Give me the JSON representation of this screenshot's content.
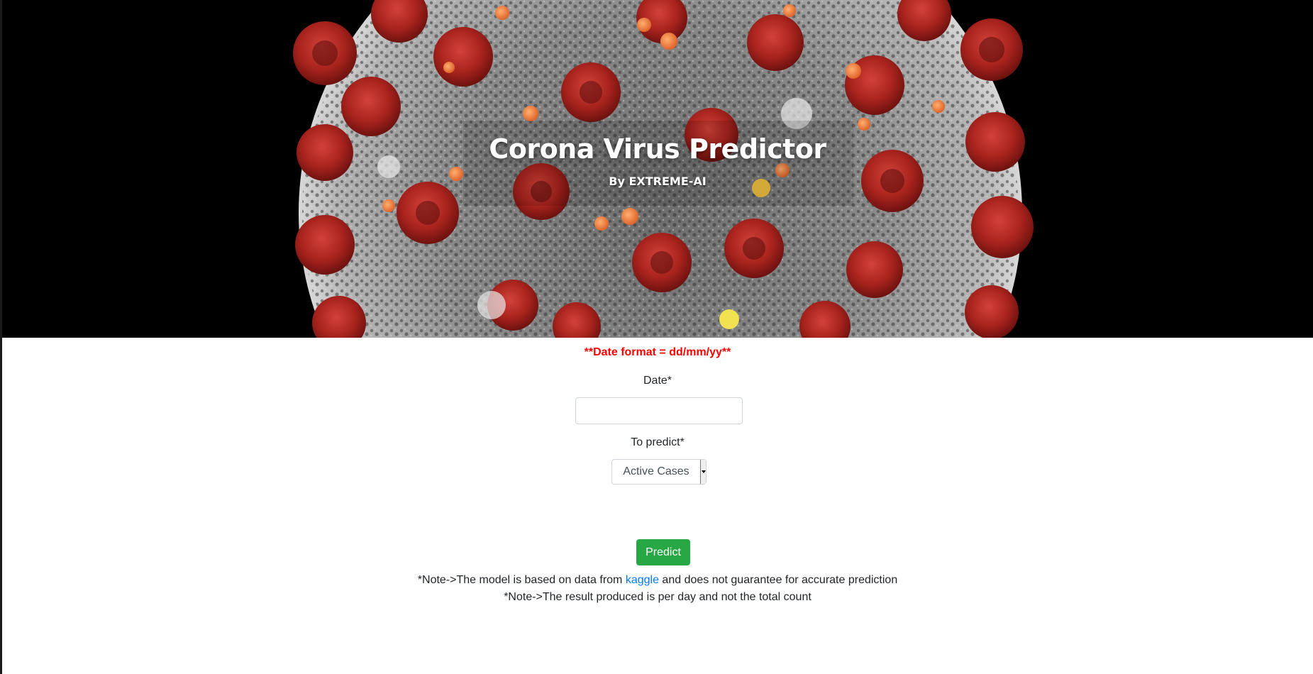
{
  "hero": {
    "title": "Corona Virus Predictor",
    "subtitle": "By EXTREME-AI"
  },
  "form": {
    "date_format_notice": "**Date format = dd/mm/yy**",
    "date_label": "Date*",
    "date_value": "",
    "to_predict_label": "To predict*",
    "to_predict_selected": "Active Cases",
    "predict_button": "Predict"
  },
  "notes": {
    "note1_prefix": "*Note->The model is based on data from ",
    "note1_link": "kaggle",
    "note1_suffix": " and does not guarantee for accurate prediction",
    "note2": "*Note->The result produced is per day and not the total count"
  },
  "colors": {
    "notice": "#ff0000",
    "button": "#28a745",
    "link": "#007bff",
    "hero_background": "#000000"
  },
  "icons": {
    "select_arrow": "chevron-down-icon"
  }
}
